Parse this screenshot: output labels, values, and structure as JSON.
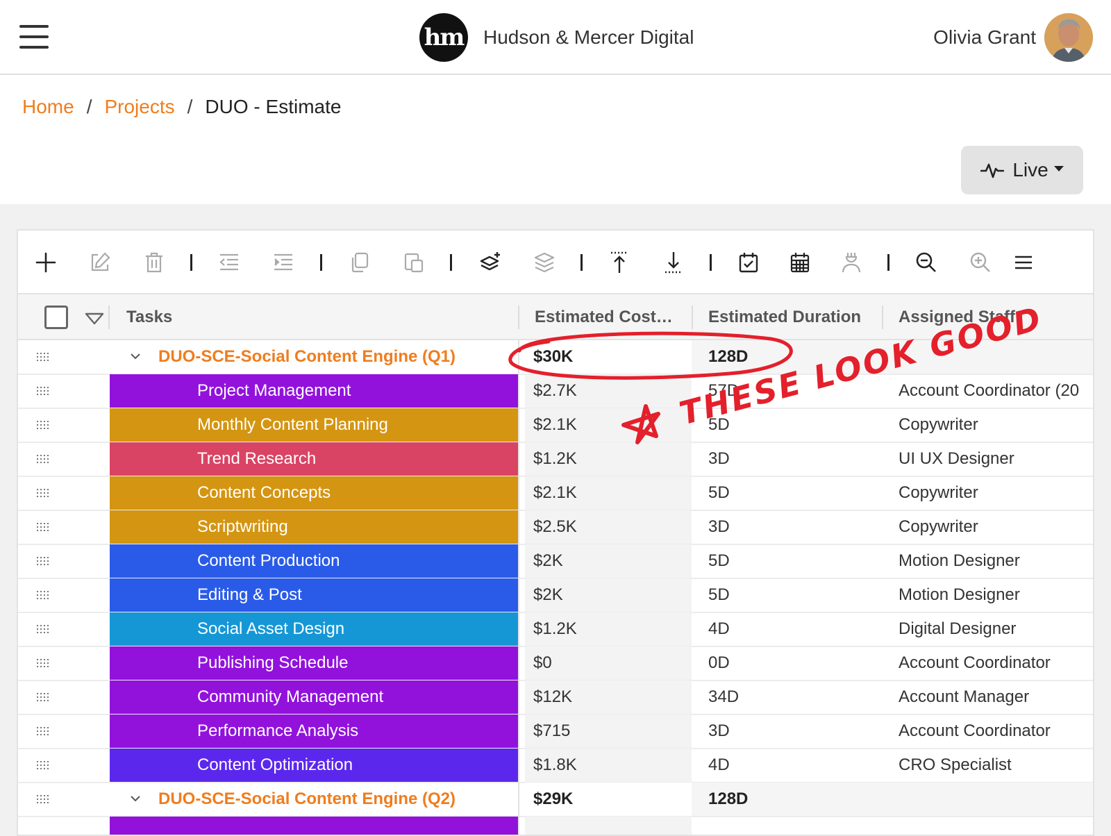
{
  "header": {
    "company": "Hudson & Mercer Digital",
    "logo_text": "hm",
    "user_name": "Olivia Grant"
  },
  "breadcrumb": {
    "home": "Home",
    "projects": "Projects",
    "current": "DUO - Estimate",
    "separator": "/"
  },
  "live_button": {
    "label": "Live"
  },
  "toolbar": {
    "icons": [
      "plus-icon",
      "edit-icon",
      "trash-icon",
      "outdent-icon",
      "indent-icon",
      "copy-icon",
      "paste-icon",
      "add-layer-icon",
      "layers-icon",
      "move-top-icon",
      "move-bottom-icon",
      "calendar-check-icon",
      "calendar-icon",
      "assign-staff-icon",
      "zoom-out-icon",
      "zoom-in-icon",
      "menu-icon"
    ]
  },
  "columns": {
    "tasks": "Tasks",
    "cost": "Estimated Cost…",
    "duration": "Estimated Duration",
    "staff": "Assigned Staff"
  },
  "groups": [
    {
      "title": "DUO-SCE-Social Content Engine (Q1)",
      "cost": "$30K",
      "duration": "128D",
      "staff": ""
    },
    {
      "title": "DUO-SCE-Social Content Engine (Q2)",
      "cost": "$29K",
      "duration": "128D",
      "staff": ""
    }
  ],
  "tasks": [
    {
      "name": "Project Management",
      "cost": "$2.7K",
      "duration": "57D",
      "staff": "Account Coordinator (20",
      "color": "#9212dc"
    },
    {
      "name": "Monthly Content Planning",
      "cost": "$2.1K",
      "duration": "5D",
      "staff": "Copywriter",
      "color": "#d49512"
    },
    {
      "name": "Trend Research",
      "cost": "$1.2K",
      "duration": "3D",
      "staff": "UI UX Designer",
      "color": "#d94464"
    },
    {
      "name": "Content Concepts",
      "cost": "$2.1K",
      "duration": "5D",
      "staff": "Copywriter",
      "color": "#d49512"
    },
    {
      "name": "Scriptwriting",
      "cost": "$2.5K",
      "duration": "3D",
      "staff": "Copywriter",
      "color": "#d49512"
    },
    {
      "name": "Content Production",
      "cost": "$2K",
      "duration": "5D",
      "staff": "Motion Designer",
      "color": "#2a5be8"
    },
    {
      "name": "Editing & Post",
      "cost": "$2K",
      "duration": "5D",
      "staff": "Motion Designer",
      "color": "#2a5be8"
    },
    {
      "name": "Social Asset Design",
      "cost": "$1.2K",
      "duration": "4D",
      "staff": "Digital Designer",
      "color": "#1597d6"
    },
    {
      "name": "Publishing Schedule",
      "cost": "$0",
      "duration": "0D",
      "staff": "Account Coordinator",
      "color": "#9212dc"
    },
    {
      "name": "Community Management",
      "cost": "$12K",
      "duration": "34D",
      "staff": "Account Manager",
      "color": "#9212dc"
    },
    {
      "name": "Performance Analysis",
      "cost": "$715",
      "duration": "3D",
      "staff": "Account Coordinator",
      "color": "#9212dc"
    },
    {
      "name": "Content Optimization",
      "cost": "$1.8K",
      "duration": "4D",
      "staff": "CRO Specialist",
      "color": "#5c27ec"
    }
  ],
  "annotation": {
    "text": "THESE LOOK GOOD",
    "color": "#e3202b"
  }
}
